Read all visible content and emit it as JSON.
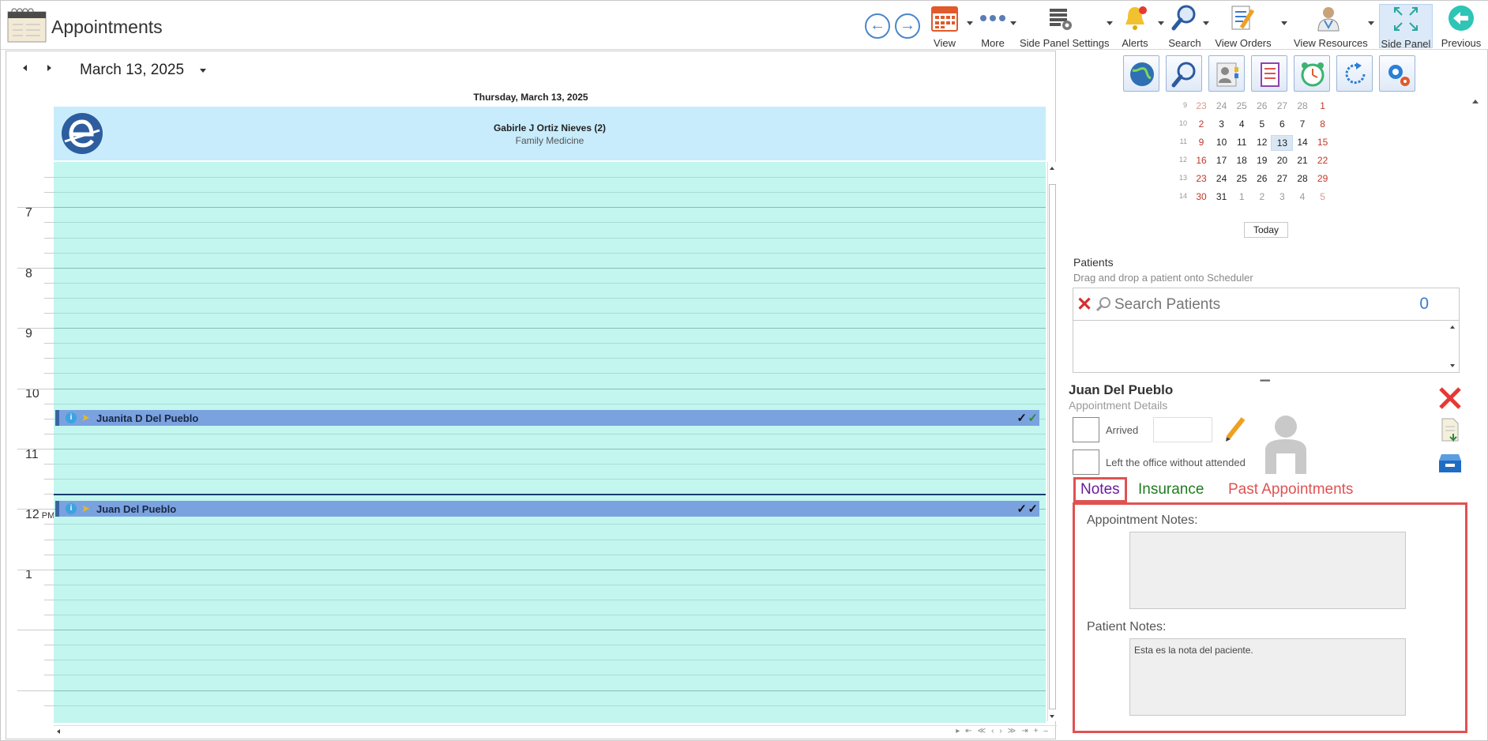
{
  "header": {
    "title": "Appointments",
    "toolbar": [
      {
        "id": "view",
        "label": "View",
        "icon": "calendar-icon"
      },
      {
        "id": "more",
        "label": "More",
        "icon": "more-dots-icon"
      },
      {
        "id": "side_panel_settings",
        "label": "Side Panel Settings",
        "icon": "table-gear-icon"
      },
      {
        "id": "alerts",
        "label": "Alerts",
        "icon": "bell-icon"
      },
      {
        "id": "search",
        "label": "Search",
        "icon": "magnifier-icon"
      },
      {
        "id": "view_orders",
        "label": "View Orders",
        "icon": "orders-pencil-icon"
      },
      {
        "id": "view_resources",
        "label": "View Resources",
        "icon": "doctor-icon"
      },
      {
        "id": "side_panel",
        "label": "Side Panel",
        "icon": "expand-arrows-icon",
        "active": true
      },
      {
        "id": "previous",
        "label": "Previous",
        "icon": "back-arrow-icon"
      }
    ],
    "labels": {
      "view": "View",
      "more": "More",
      "side_panel_settings": "Side Panel Settings",
      "alerts": "Alerts",
      "search": "Search",
      "view_orders": "View Orders",
      "view_resources": "View Resources",
      "side_panel": "Side Panel",
      "previous": "Previous"
    }
  },
  "scheduler": {
    "date": "March 13, 2025",
    "day_heading": "Thursday, March 13, 2025",
    "resource": {
      "name": "Gabirle J Ortiz Nieves (2)",
      "specialty": "Family Medicine"
    },
    "hours": [
      {
        "label": "7",
        "ampm": ""
      },
      {
        "label": "8",
        "ampm": ""
      },
      {
        "label": "9",
        "ampm": ""
      },
      {
        "label": "10",
        "ampm": ""
      },
      {
        "label": "11",
        "ampm": ""
      },
      {
        "label": "12",
        "ampm": "PM"
      },
      {
        "label": "1",
        "ampm": ""
      }
    ],
    "appointments": [
      {
        "name": "Juanita D Del Pueblo"
      },
      {
        "name": "Juan Del Pueblo"
      }
    ]
  },
  "side_panel": {
    "tools": [
      "globe-icon",
      "magnifier-icon",
      "contact-card-icon",
      "clipboard-icon",
      "alarm-clock-icon",
      "refresh-icon",
      "gears-icon"
    ],
    "calendar": {
      "weeks": [
        {
          "wk": "9",
          "days": [
            "23",
            "24",
            "25",
            "26",
            "27",
            "28",
            "1"
          ]
        },
        {
          "wk": "10",
          "days": [
            "2",
            "3",
            "4",
            "5",
            "6",
            "7",
            "8"
          ]
        },
        {
          "wk": "11",
          "days": [
            "9",
            "10",
            "11",
            "12",
            "13",
            "14",
            "15"
          ]
        },
        {
          "wk": "12",
          "days": [
            "16",
            "17",
            "18",
            "19",
            "20",
            "21",
            "22"
          ]
        },
        {
          "wk": "13",
          "days": [
            "23",
            "24",
            "25",
            "26",
            "27",
            "28",
            "29"
          ]
        },
        {
          "wk": "14",
          "days": [
            "30",
            "31",
            "1",
            "2",
            "3",
            "4",
            "5"
          ]
        }
      ],
      "selected": "13",
      "today_label": "Today"
    },
    "patients": {
      "title": "Patients",
      "subtitle": "Drag and drop a patient onto Scheduler",
      "search_placeholder": "Search Patients",
      "count": "0"
    },
    "details": {
      "patient_name": "Juan Del Pueblo",
      "subtitle": "Appointment Details",
      "arrived_label": "Arrived",
      "left_office_label": "Left the office without attended",
      "tabs": {
        "notes": "Notes",
        "insurance": "Insurance",
        "past": "Past Appointments"
      },
      "appointment_notes_label": "Appointment Notes:",
      "appointment_notes": "",
      "patient_notes_label": "Patient Notes:",
      "patient_notes": "Esta es la nota del paciente."
    }
  },
  "colors": {
    "accent": "#4a86c8",
    "grid": "#c2f6ef",
    "resource_header": "#c8ecfb",
    "appointment": "#7aa2df",
    "highlight": "#e05252"
  }
}
